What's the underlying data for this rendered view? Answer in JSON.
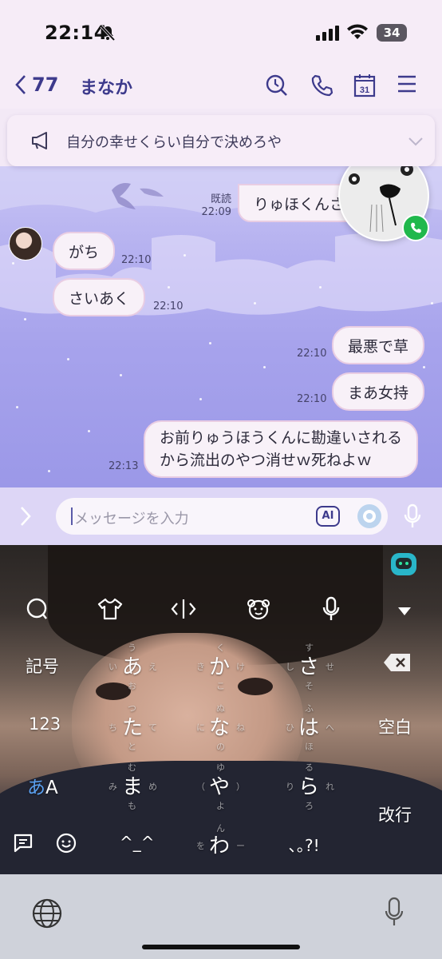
{
  "status_bar": {
    "time": "22:14",
    "battery": "34"
  },
  "header": {
    "back_count": "77",
    "contact_name": "まなか"
  },
  "announcement": {
    "text": "自分の幸せくらい自分で決めろや"
  },
  "messages": [
    {
      "side": "right",
      "text": "りゅほくんさ",
      "read_label": "既読",
      "time": "22:09"
    },
    {
      "side": "left",
      "text": "がち",
      "time": "22:10"
    },
    {
      "side": "left",
      "text": "さいあく",
      "time": "22:10"
    },
    {
      "side": "right",
      "text": "最悪で草",
      "time": "22:10"
    },
    {
      "side": "right",
      "text": "まあ女持",
      "time": "22:10"
    },
    {
      "side": "right",
      "text_line1": "お前りゅうほうくんに勘違いされる",
      "text_line2": "から流出のやつ消せｗ死ねよｗ",
      "time": "22:13"
    }
  ],
  "input": {
    "placeholder": "メッセージを入力",
    "ai_label": "AI"
  },
  "keyboard": {
    "left_keys": {
      "symbols": "記号",
      "numbers": "123",
      "mode_a": "あ",
      "mode_b": "A"
    },
    "keys": {
      "a": "あ",
      "ka": "か",
      "sa": "さ",
      "ta": "た",
      "na": "な",
      "ha": "は",
      "ma": "ま",
      "ya": "や",
      "ra": "ら",
      "kaomoji": "^_^",
      "wa": "わ",
      "punct": "､｡?!"
    },
    "hints": {
      "a": [
        "う",
        "い",
        "え",
        "お"
      ],
      "ka": [
        "く",
        "き",
        "け",
        "こ"
      ],
      "sa": [
        "す",
        "し",
        "せ",
        "そ"
      ],
      "ta": [
        "つ",
        "ち",
        "て",
        "と"
      ],
      "na": [
        "ぬ",
        "に",
        "ね",
        "の"
      ],
      "ha": [
        "ふ",
        "ひ",
        "へ",
        "ほ"
      ],
      "ma": [
        "む",
        "み",
        "め",
        "も"
      ],
      "ya": [
        "ゆ",
        "（",
        "）",
        "よ"
      ],
      "ra": [
        "る",
        "り",
        "れ",
        "ろ"
      ],
      "wa": [
        "ん",
        "を",
        "ー",
        ""
      ]
    },
    "right_keys": {
      "space": "空白",
      "enter": "改行"
    }
  }
}
